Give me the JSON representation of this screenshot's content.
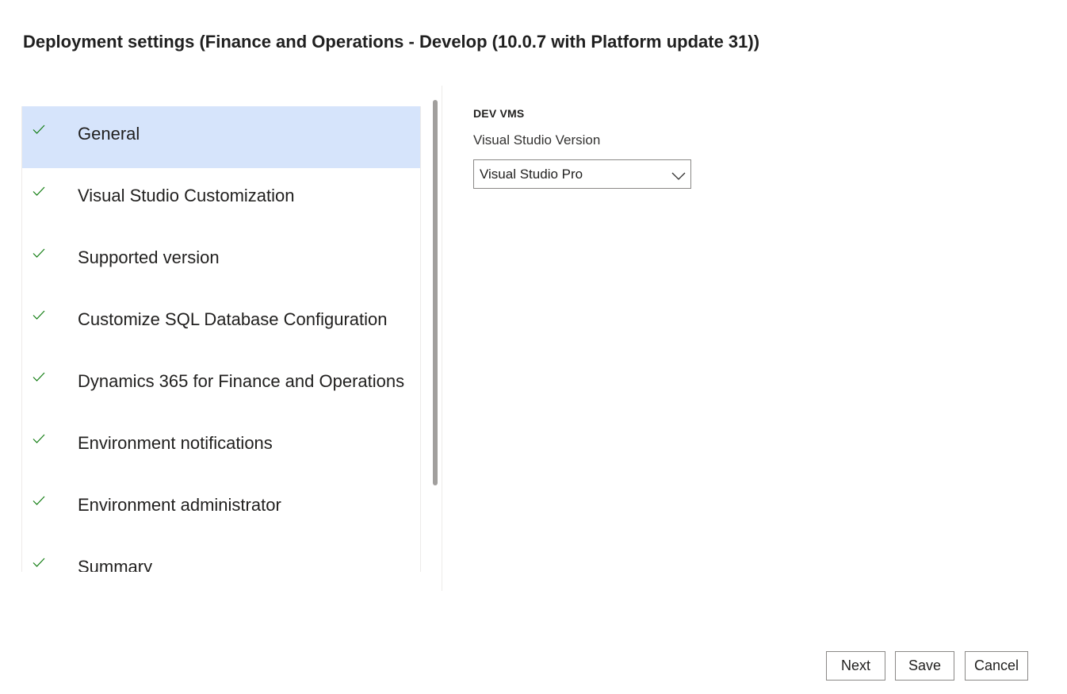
{
  "dialog": {
    "title": "Deployment settings (Finance and Operations - Develop (10.0.7 with Platform update 31))"
  },
  "nav": {
    "items": [
      {
        "label": "General",
        "selected": true,
        "status": "check-icon"
      },
      {
        "label": "Visual Studio Customization",
        "selected": false,
        "status": "check-icon"
      },
      {
        "label": "Supported version",
        "selected": false,
        "status": "check-icon"
      },
      {
        "label": "Customize SQL Database Configuration",
        "selected": false,
        "status": "check-icon"
      },
      {
        "label": "Dynamics 365 for Finance and Operations",
        "selected": false,
        "status": "check-icon"
      },
      {
        "label": "Environment notifications",
        "selected": false,
        "status": "check-icon"
      },
      {
        "label": "Environment administrator",
        "selected": false,
        "status": "check-icon"
      },
      {
        "label": "Summary",
        "selected": false,
        "status": "check-icon"
      }
    ]
  },
  "content": {
    "section_heading": "DEV VMS",
    "vs_version": {
      "label": "Visual Studio Version",
      "selected_value": "Visual Studio Pro"
    }
  },
  "footer": {
    "next_label": "Next",
    "save_label": "Save",
    "cancel_label": "Cancel"
  },
  "colors": {
    "selected_bg": "#d6e4fb",
    "check_color": "#107c10",
    "border": "#8a8886"
  }
}
